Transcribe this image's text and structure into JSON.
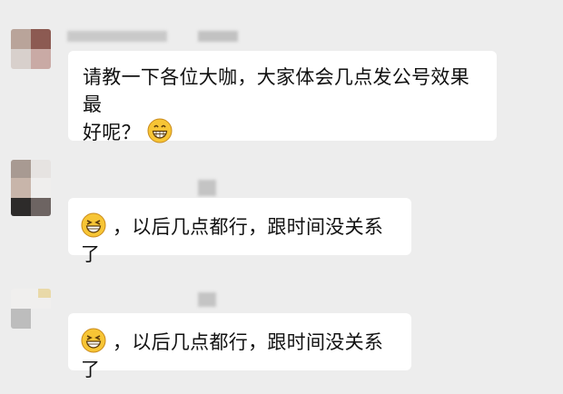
{
  "messages": [
    {
      "sender": "user-1",
      "text_line1": "请教一下各位大咖，大家体会几点发公号效果最",
      "text_line2": "好呢？",
      "emoji": "grinning-face-icon"
    },
    {
      "sender": "user-2",
      "emoji": "squinting-grin-icon",
      "text": "，以后几点都行，跟时间没关系了"
    },
    {
      "sender": "user-3",
      "emoji": "squinting-grin-icon",
      "text": "，以后几点都行，跟时间没关系了"
    }
  ],
  "colors": {
    "background": "#ededed",
    "bubble": "#ffffff",
    "text": "#111111",
    "emoji_yellow": "#f7c535"
  }
}
